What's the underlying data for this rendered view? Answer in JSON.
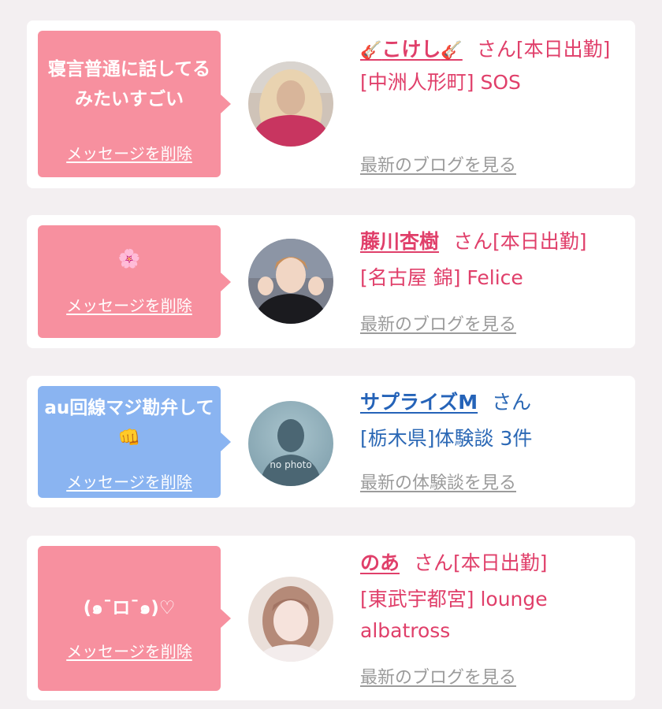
{
  "delete_label": "メッセージを削除",
  "cards": [
    {
      "message": "寝言普通に話してるみたいすごい",
      "name_icon": "guitar-emoji",
      "name_icon_glyph": "🎸",
      "name": "こけし",
      "suffix": "さん[本日出勤]",
      "shop": "[中洲人形町] SOS",
      "link": "最新のブログを見る",
      "bubble_color": "#f7909f"
    },
    {
      "message": "🌸",
      "name": "藤川杏樹",
      "suffix": "さん[本日出勤]",
      "shop": "[名古屋 錦] Felice",
      "link": "最新のブログを見る",
      "bubble_color": "#f7909f"
    },
    {
      "message": "au回線マジ勘弁して👊",
      "name": "サプライズM",
      "suffix": "さん",
      "shop": "[栃木県]体験談 3件",
      "link": "最新の体験談を見る",
      "avatar_text": "no photo",
      "bubble_color": "#8ab4f1"
    },
    {
      "message": "(๑¯ロ¯๑)♡",
      "name": "のあ",
      "suffix": "さん[本日出勤]",
      "shop": "[東武宇都宮] lounge albatross",
      "link": "最新のブログを見る",
      "bubble_color": "#f7909f"
    }
  ],
  "colors": {
    "pink_bubble": "#f7909f",
    "blue_bubble": "#8ab4f1",
    "pink_text": "#e03f6a",
    "blue_text": "#2563b8",
    "link_gray": "#9b9b9b"
  }
}
